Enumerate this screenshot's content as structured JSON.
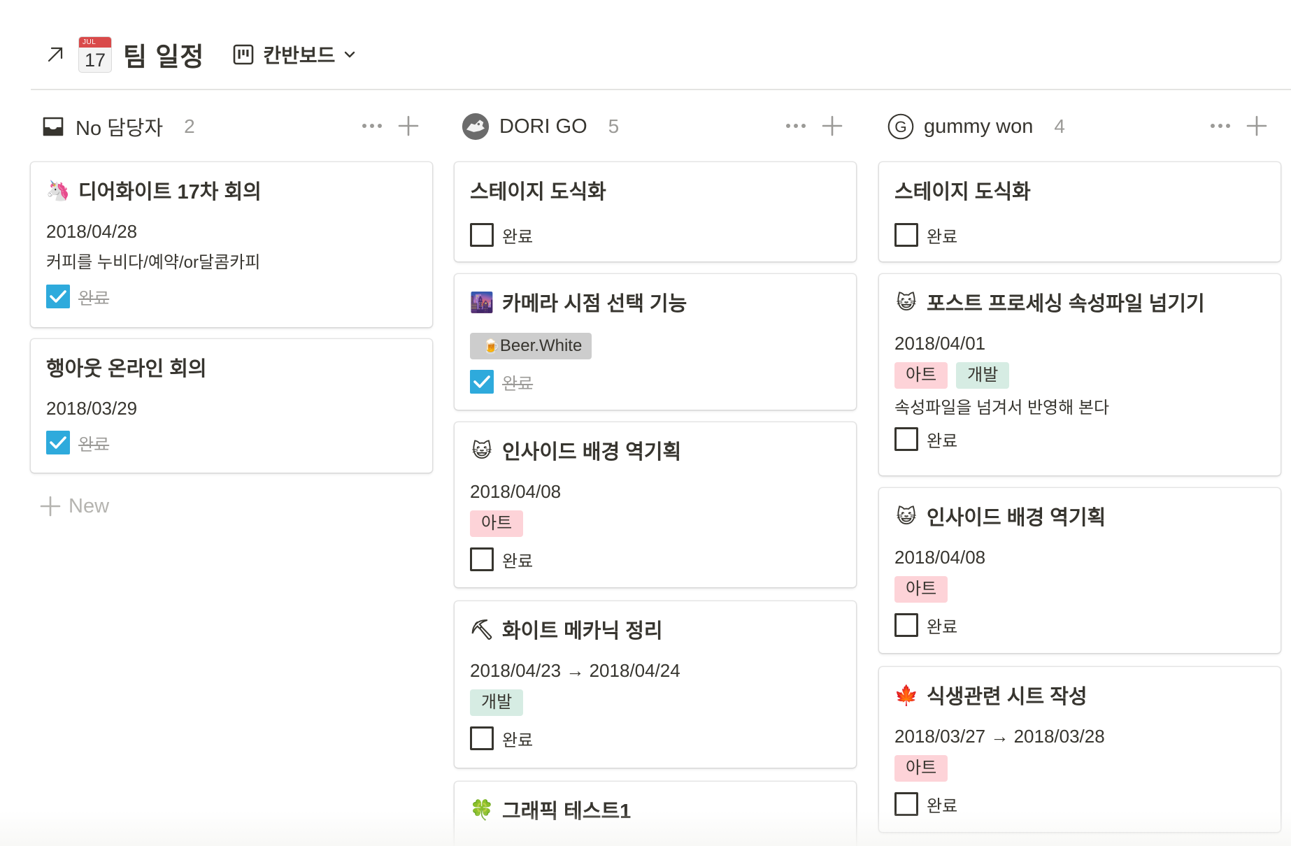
{
  "header": {
    "calendar_month": "JUL",
    "calendar_day": "17",
    "title": "팀 일정",
    "view_label": "칸반보드"
  },
  "columns": [
    {
      "name": "No 담당자",
      "count": "2",
      "icon": "inbox-icon",
      "cards": [
        {
          "title": "디어화이트 17차 회의",
          "emoji": "🦄",
          "date": "2018/04/28",
          "note": "커피를 누비다/예약/or달콤카피",
          "checkbox_label": "완료",
          "checked": true
        },
        {
          "title": "행아웃 온라인 회의",
          "date": "2018/03/29",
          "checkbox_label": "완료",
          "checked": true
        }
      ],
      "new_label": "New"
    },
    {
      "name": "DORI GO",
      "count": "5",
      "icon": "avatar-icon",
      "cards": [
        {
          "title": "스테이지 도식화",
          "checkbox_label": "완료",
          "checked": false
        },
        {
          "title": "카메라 시점 선택 기능",
          "emoji": "🌆",
          "person_tag": "Beer.White",
          "person_emoji": "🍺",
          "checkbox_label": "완료",
          "checked": true
        },
        {
          "title": "인사이드 배경 역기획",
          "emoji": "😺",
          "date": "2018/04/08",
          "tags": [
            "아트"
          ],
          "checkbox_label": "완료",
          "checked": false
        },
        {
          "title": "화이트 메카닉 정리",
          "emoji": "⛏",
          "date": "2018/04/23 → 2018/04/24",
          "tags": [
            "개발"
          ],
          "checkbox_label": "완료",
          "checked": false
        },
        {
          "title": "그래픽 테스트1",
          "emoji": "🍀"
        }
      ]
    },
    {
      "name": "gummy won",
      "count": "4",
      "icon": "g-initial-icon",
      "initial": "G",
      "cards": [
        {
          "title": "스테이지 도식화",
          "checkbox_label": "완료",
          "checked": false
        },
        {
          "title": "포스트 프로세싱 속성파일 넘기기",
          "emoji": "😺",
          "date": "2018/04/01",
          "tags": [
            "아트",
            "개발"
          ],
          "note": "속성파일을 넘겨서 반영해 본다",
          "checkbox_label": "완료",
          "checked": false
        },
        {
          "title": "인사이드 배경 역기획",
          "emoji": "😺",
          "date": "2018/04/08",
          "tags": [
            "아트"
          ],
          "checkbox_label": "완료",
          "checked": false
        },
        {
          "title": "식생관련 시트 작성",
          "emoji": "🍁",
          "date": "2018/03/27 → 2018/03/28",
          "tags": [
            "아트"
          ],
          "checkbox_label": "완료",
          "checked": false
        }
      ]
    }
  ],
  "colors": {
    "text": "#37352f",
    "muted": "#9b9a97",
    "checked": "#2eaadc",
    "tag_art": "#fdd3d8",
    "tag_dev": "#d6ece3",
    "tag_person": "#cdcdcd",
    "calendar_red": "#d94a4a"
  }
}
